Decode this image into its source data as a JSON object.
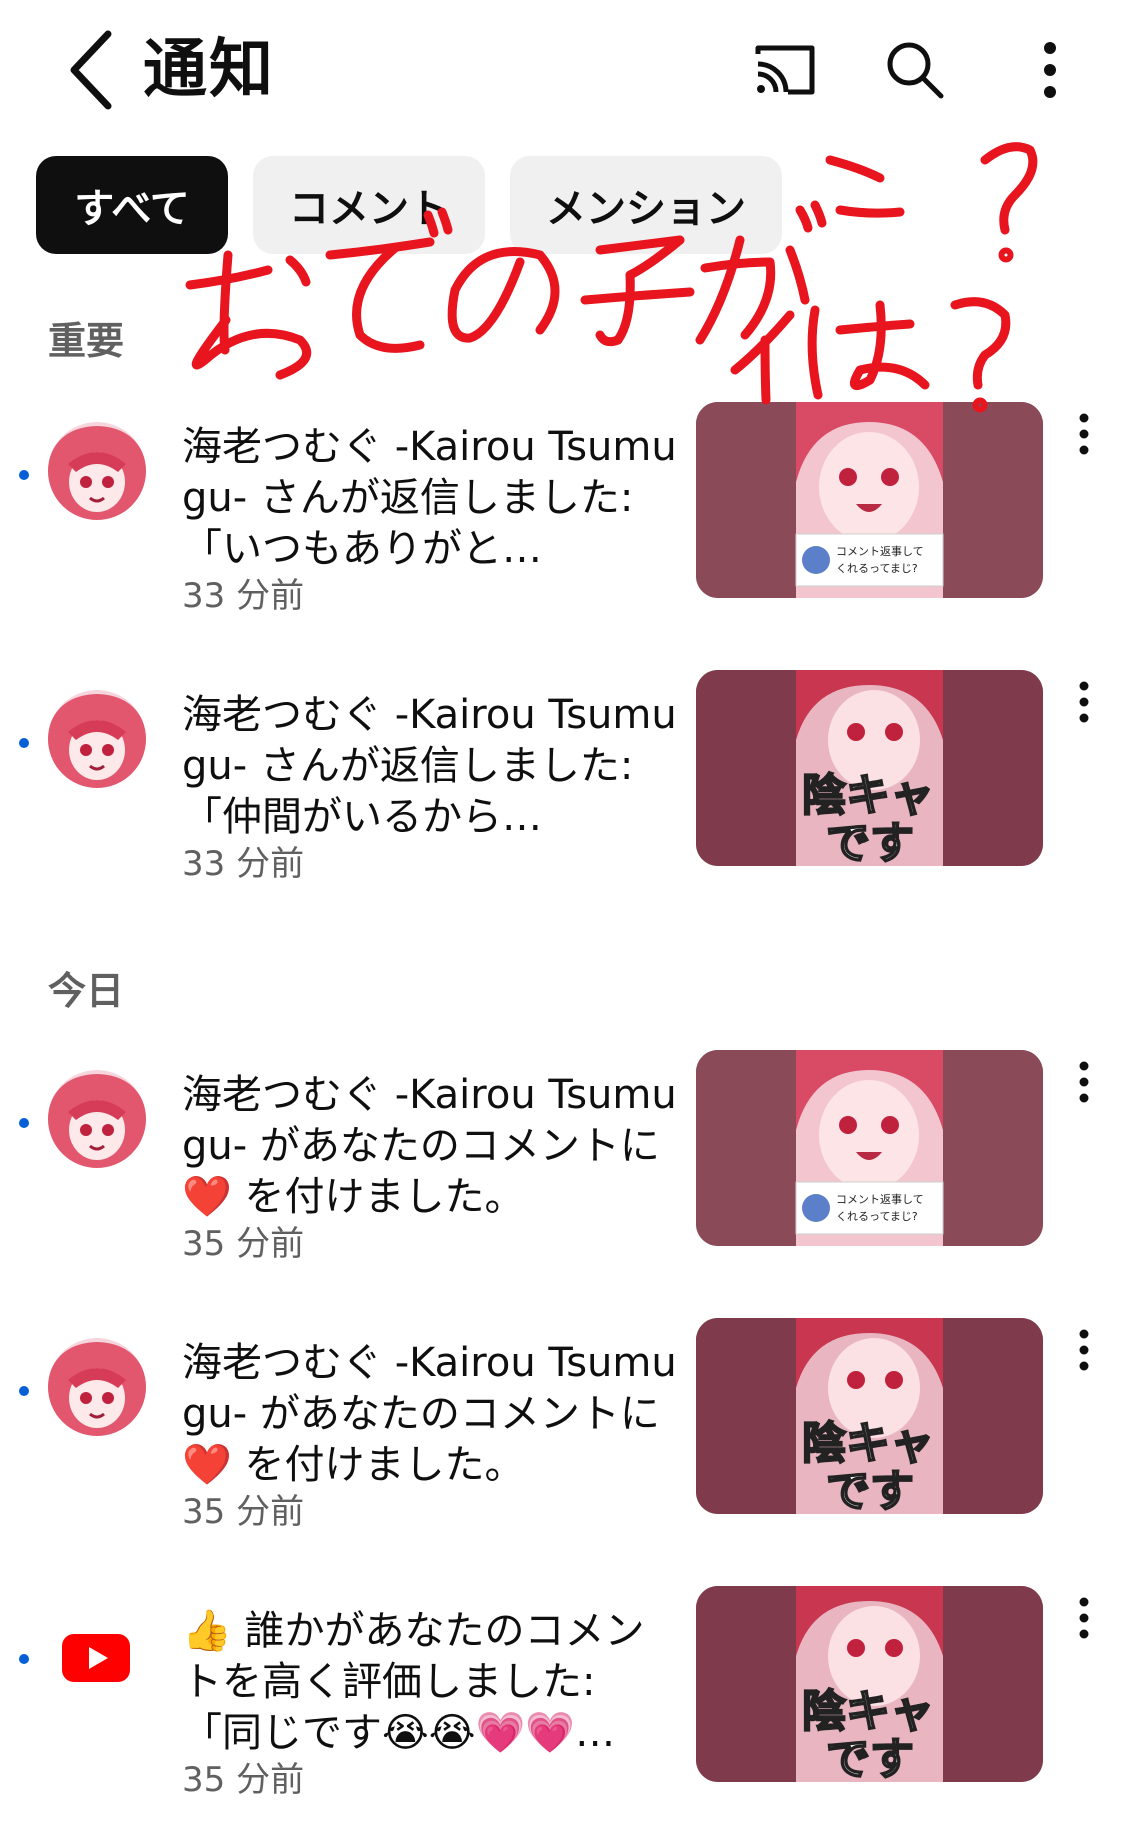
{
  "header": {
    "title": "通知",
    "icons": [
      "back-arrow-icon",
      "cast-icon",
      "search-icon",
      "more-vert-icon"
    ]
  },
  "filters": [
    {
      "label": "すべて",
      "selected": true
    },
    {
      "label": "コメント",
      "selected": false
    },
    {
      "label": "メンション",
      "selected": false
    }
  ],
  "handwritten_note": "おでの子がこ?イは?",
  "sections": {
    "important": "重要",
    "today": "今日"
  },
  "notifications": [
    {
      "text": "海老つむぐ -Kairou Tsumugu- さんが返信しました: 「いつもありがと…",
      "time": "33 分前",
      "unread": true,
      "thumb_overlay": "コメント返事してくれるってまじ?"
    },
    {
      "text": "海老つむぐ -Kairou Tsumugu- さんが返信しました: 「仲間がいるから…",
      "time": "33 分前",
      "unread": true,
      "thumb_overlay": "陰キャです"
    },
    {
      "text": "海老つむぐ -Kairou Tsumugu- があなたのコメントに ❤️ を付けました。",
      "time": "35 分前",
      "unread": true,
      "thumb_overlay": "コメント返事してくれるってまじ?"
    },
    {
      "text": "海老つむぐ -Kairou Tsumugu- があなたのコメントに ❤️ を付けました。",
      "time": "35 分前",
      "unread": true,
      "thumb_overlay": "陰キャです"
    },
    {
      "text": "👍 誰かがあなたのコメントを高く評価しました: 「同じです😭😭💗💗…",
      "time": "35 分前",
      "unread": true,
      "thumb_overlay": "陰キャです"
    }
  ],
  "colors": {
    "accent_blue": "#065fd4",
    "youtube_red": "#ff0000",
    "chip_active": "#0f0f0f",
    "chip_inactive": "#f0f0f0",
    "scribble_red": "#e8141e"
  }
}
